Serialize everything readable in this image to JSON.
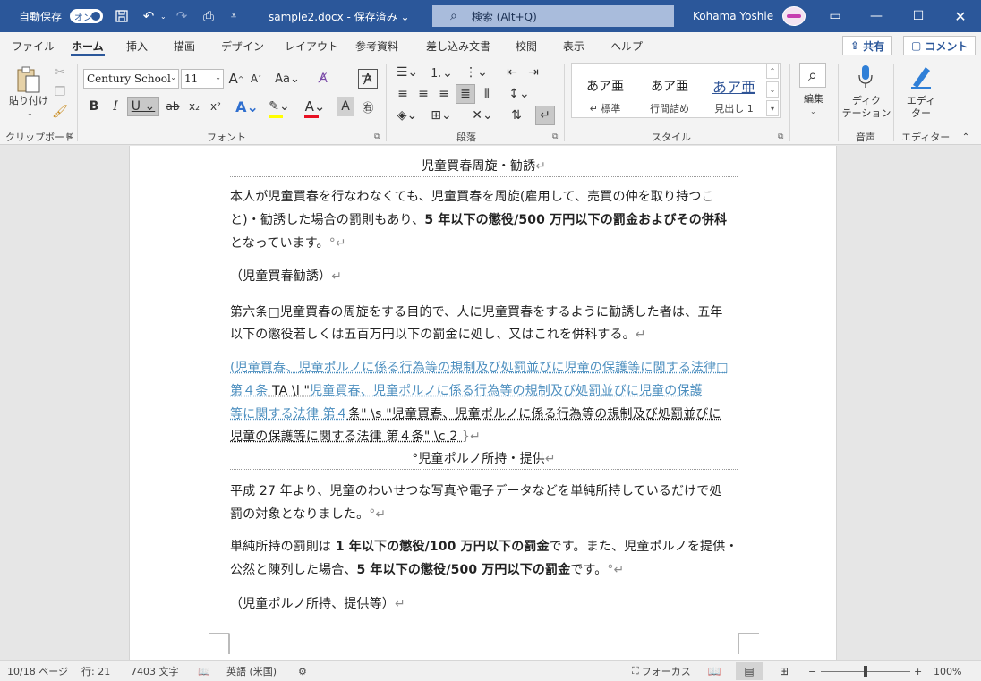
{
  "titlebar": {
    "autosave_label": "自動保存",
    "autosave_state": "オン",
    "document_title": "sample2.docx - 保存済み ⌄",
    "search_label": "検索 (Alt+Q)",
    "user_name": "Kohama Yoshie",
    "icons": [
      "save-icon",
      "undo-icon",
      "redo-icon",
      "touch-mode-icon",
      "customize-qat-icon"
    ]
  },
  "tabs": [
    "ファイル",
    "ホーム",
    "挿入",
    "描画",
    "デザイン",
    "レイアウト",
    "参考資料",
    "差し込み文書",
    "校閲",
    "表示",
    "ヘルプ"
  ],
  "active_tab": "ホーム",
  "share_label": "共有",
  "comment_label": "コメント",
  "ribbon": {
    "clipboard": {
      "paste_label": "貼り付け",
      "group": "クリップボード"
    },
    "font": {
      "family": "Century School",
      "size": "11",
      "group": "フォント"
    },
    "paragraph": {
      "group": "段落"
    },
    "styles": {
      "items": [
        {
          "preview": "あア亜",
          "name": "↵ 標準"
        },
        {
          "preview": "あア亜",
          "name": "行間詰め"
        },
        {
          "preview": "あア亜",
          "name": "見出し 1"
        }
      ],
      "group": "スタイル"
    },
    "editing_label": "編集",
    "dictation_label_1": "ディク",
    "dictation_label_2": "テーション",
    "voice_group": "音声",
    "editor_label_1": "エディ",
    "editor_label_2": "ター",
    "editor_group": "エディター"
  },
  "document": {
    "heading1": "児童買春周旋・勧誘",
    "p1_l1": "本人が児童買春を行なわなくても、児童買春を周旋(雇用して、売買の仲を取り持つこ",
    "p1_l2a": "と)・勧誘した場合の罰則もあり、",
    "p1_l2b": "5 年以下の懲役/500 万円以下の罰金およびその併科",
    "p1_l3": "となっています。",
    "p2": "（児童買春勧誘）",
    "p3_l1": "第六条□児童買春の周旋をする目的で、人に児童買春をするように勧誘した者は、五年",
    "p3_l2": "以下の懲役若しくは五百万円以下の罰金に処し、又はこれを併科する。",
    "p4_l1": "(児童買春、児童ポルノに係る行為等の規制及び処罰並びに児童の保護等に関する法律□",
    "p4_l2a": "第４条",
    "p4_l2b": " TA \\l \"",
    "p4_l2c": "児童買春、児童ポルノに係る行為等の規制及び処罰並びに児童の保護",
    "p4_l3a": "等に関する法律 第４",
    "p4_l3b": "条\" \\s \"児童買春、児童ポルノに係る行為等の規制及び処罰並びに",
    "p4_l4": "児童の保護等に関する法律 第４条\" \\c 2 ",
    "heading2": "°児童ポルノ所持・提供",
    "p5_l1": "平成 27 年より、児童のわいせつな写真や電子データなどを単純所持しているだけで処",
    "p5_l2": "罰の対象となりました。",
    "p6_l1a": "単純所持の罰則は ",
    "p6_l1b": "1 年以下の懲役/100 万円以下の罰金",
    "p6_l1c": "です。また、児童ポルノを提供・",
    "p6_l2a": "公然と陳列した場合、",
    "p6_l2b": "5 年以下の懲役/500 万円以下の罰金",
    "p6_l2c": "です。",
    "p7": "（児童ポルノ所持、提供等）"
  },
  "status": {
    "page": "10/18 ページ",
    "line": "行: 21",
    "words": "7403 文字",
    "language": "英語 (米国)",
    "focus": "フォーカス",
    "zoom": "100%",
    "zoom_level_percent": 100
  }
}
